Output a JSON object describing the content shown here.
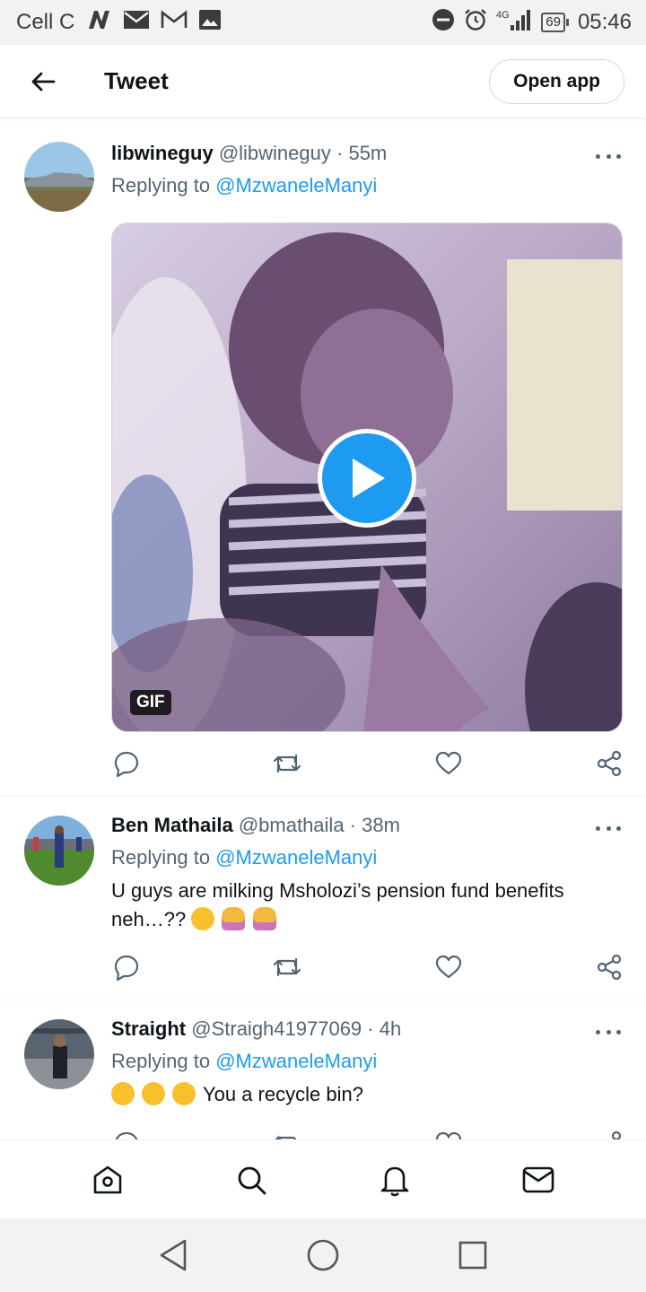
{
  "status_bar": {
    "carrier": "Cell C",
    "network_type": "4G",
    "battery_level": "69",
    "time": "05:46",
    "icons": [
      "n-app-icon",
      "mail-icon",
      "gmail-icon",
      "image-icon",
      "dnd-icon",
      "alarm-icon",
      "signal-icon",
      "battery-icon"
    ]
  },
  "header": {
    "title": "Tweet",
    "open_app_label": "Open app"
  },
  "tweets": [
    {
      "name": "libwineguy",
      "handle": "@libwineguy",
      "separator": "·",
      "time": "55m",
      "replying_prefix": "Replying to",
      "replying_to": "@MzwaneleManyi",
      "text": "",
      "media_badge": "GIF"
    },
    {
      "name": "Ben Mathaila",
      "handle": "@bmathaila",
      "separator": "·",
      "time": "38m",
      "replying_prefix": "Replying to",
      "replying_to": "@MzwaneleManyi",
      "text": "U guys are milking Msholozi’s pension fund benefits neh…??"
    },
    {
      "name": "Straight",
      "handle": "@Straigh41977069",
      "separator": "·",
      "time": "4h",
      "replying_prefix": "Replying to",
      "replying_to": "@MzwaneleManyi",
      "text": "You a recycle bin?"
    }
  ],
  "colors": {
    "accent": "#1d9bf0",
    "text_primary": "#0f1419",
    "text_secondary": "#536471"
  },
  "bottom_nav": [
    "home-icon",
    "search-icon",
    "notifications-icon",
    "messages-icon"
  ],
  "system_nav": [
    "back-triangle-icon",
    "home-circle-icon",
    "recents-square-icon"
  ]
}
